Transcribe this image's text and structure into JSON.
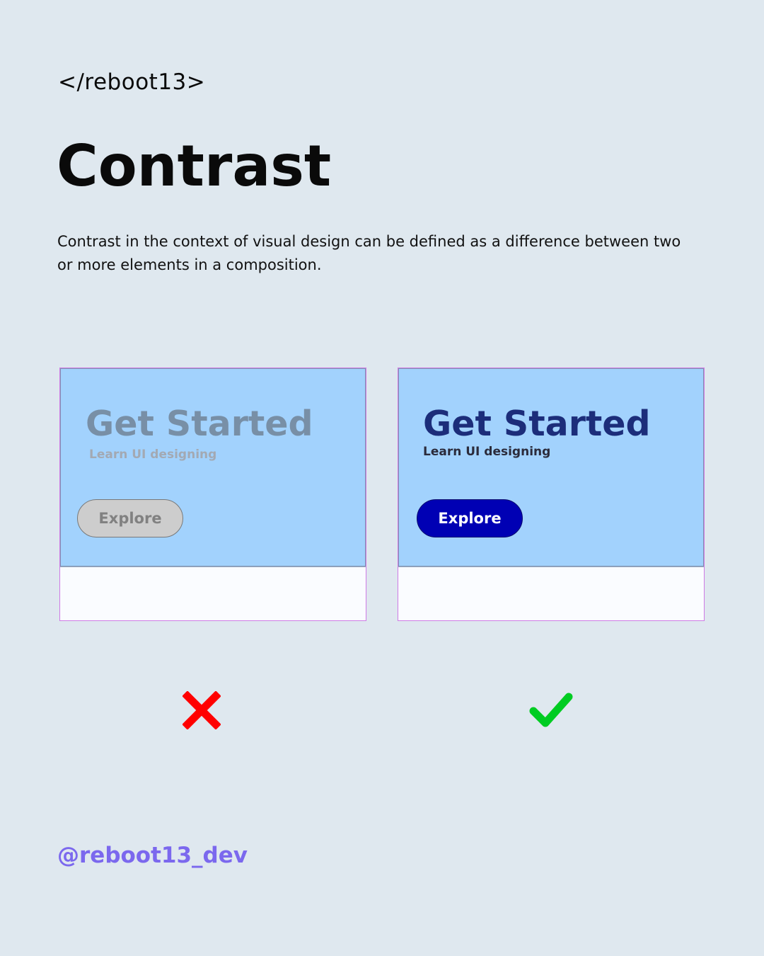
{
  "brand": "</reboot13>",
  "title": "Contrast",
  "description": "Contrast in the context of visual design can be defined as a difference between two or more elements in a composition.",
  "cards": {
    "bad": {
      "headline": "Get Started",
      "subtitle": "Learn UI designing",
      "button_label": "Explore",
      "verdict_icon": "cross-icon",
      "verdict_color": "#ff0000"
    },
    "good": {
      "headline": "Get Started",
      "subtitle": "Learn UI designing",
      "button_label": "Explore",
      "verdict_icon": "check-icon",
      "verdict_color": "#00cc22"
    }
  },
  "colors": {
    "background": "#dfe8ef",
    "card_top": "#a2d2fd",
    "good_button": "#0000b4",
    "bad_button": "#cdcdcd",
    "handle": "#7b68ee"
  },
  "handle": "@reboot13_dev"
}
